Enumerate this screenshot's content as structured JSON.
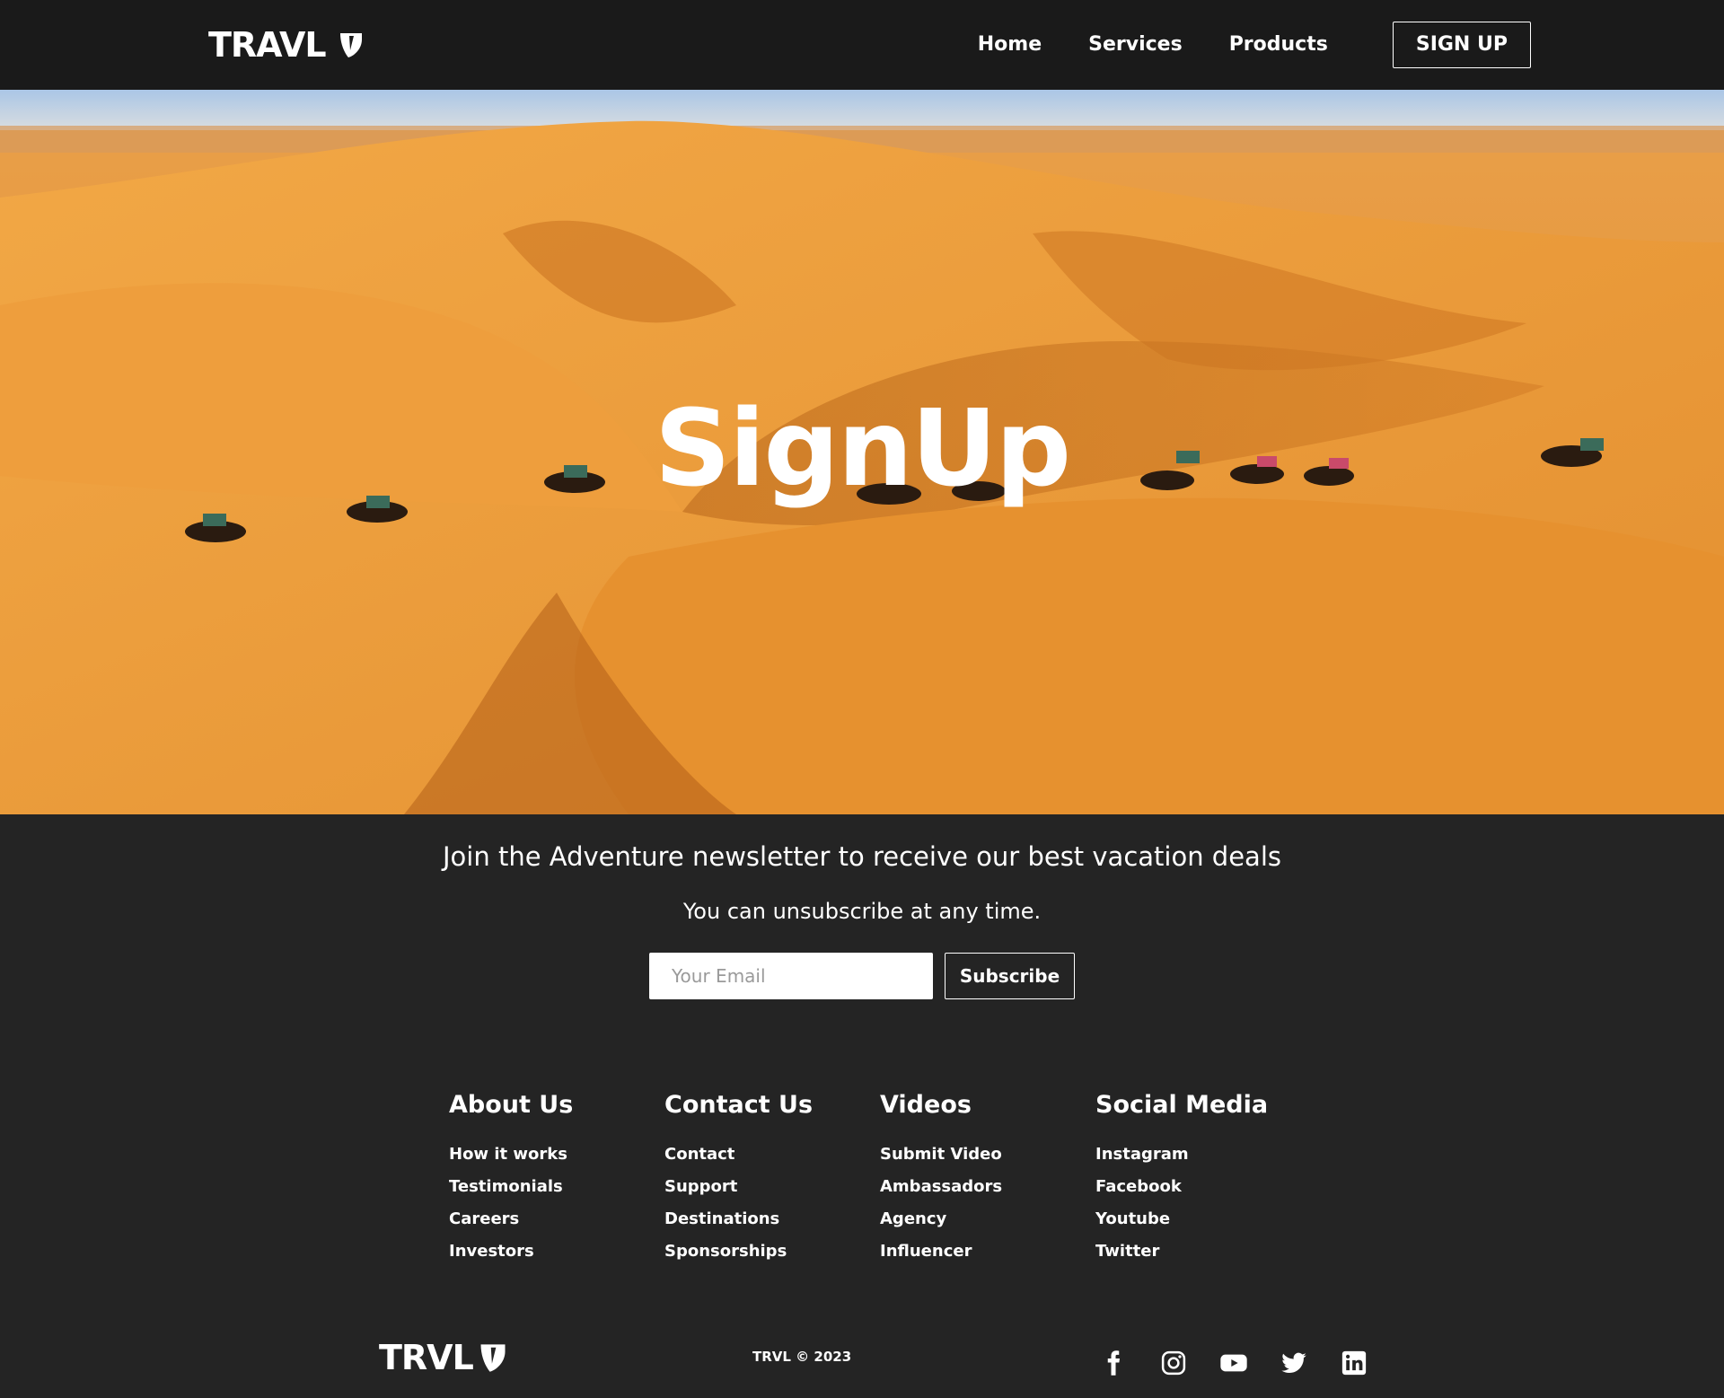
{
  "nav": {
    "logo_text": "TRAVL",
    "links": [
      "Home",
      "Services",
      "Products"
    ],
    "signup_label": "SIGN UP"
  },
  "hero": {
    "title": "SignUp"
  },
  "newsletter": {
    "heading": "Join the Adventure newsletter to receive our best vacation deals",
    "subtext": "You can unsubscribe at any time.",
    "email_placeholder": "Your Email",
    "subscribe_label": "Subscribe"
  },
  "footer": {
    "columns": [
      {
        "title": "About Us",
        "links": [
          "How it works",
          "Testimonials",
          "Careers",
          "Investors"
        ]
      },
      {
        "title": "Contact Us",
        "links": [
          "Contact",
          "Support",
          "Destinations",
          "Sponsorships"
        ]
      },
      {
        "title": "Videos",
        "links": [
          "Submit Video",
          "Ambassadors",
          "Agency",
          "Influencer"
        ]
      },
      {
        "title": "Social Media",
        "links": [
          "Instagram",
          "Facebook",
          "Youtube",
          "Twitter"
        ]
      }
    ],
    "logo_text": "TRVL",
    "copyright": "TRVL © 2023",
    "social_icons": [
      "facebook-icon",
      "instagram-icon",
      "youtube-icon",
      "twitter-icon",
      "linkedin-icon"
    ]
  },
  "colors": {
    "nav_bg": "#1a1a1a",
    "page_bg": "#242424",
    "sand": "#e89a3a",
    "sky": "#b5cfe6"
  }
}
